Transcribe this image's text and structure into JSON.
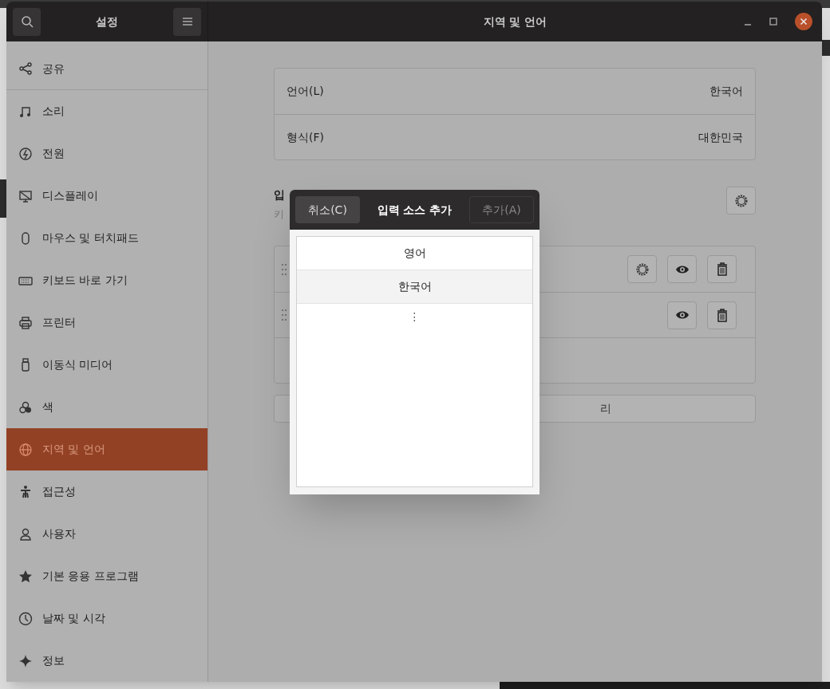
{
  "window": {
    "title": "설정",
    "page_title": "지역 및 언어"
  },
  "sidebar": {
    "items": [
      {
        "label": "공유",
        "selected": false
      },
      {
        "label": "소리",
        "selected": false
      },
      {
        "label": "전원",
        "selected": false
      },
      {
        "label": "디스플레이",
        "selected": false
      },
      {
        "label": "마우스 및 터치패드",
        "selected": false
      },
      {
        "label": "키보드 바로 가기",
        "selected": false
      },
      {
        "label": "프린터",
        "selected": false
      },
      {
        "label": "이동식 미디어",
        "selected": false
      },
      {
        "label": "색",
        "selected": false
      },
      {
        "label": "지역 및 언어",
        "selected": true
      },
      {
        "label": "접근성",
        "selected": false
      },
      {
        "label": "사용자",
        "selected": false
      },
      {
        "label": "기본 응용 프로그램",
        "selected": false
      },
      {
        "label": "날짜 및 시각",
        "selected": false
      },
      {
        "label": "정보",
        "selected": false
      }
    ]
  },
  "language": {
    "rows": [
      {
        "label": "언어(L)",
        "value": "한국어"
      },
      {
        "label": "형식(F)",
        "value": "대한민국"
      }
    ]
  },
  "input_sources": {
    "heading": "입",
    "subtitle": "키",
    "rows": [
      {
        "kind": "with_settings"
      },
      {
        "kind": "plain"
      },
      {
        "kind": "empty"
      }
    ],
    "manage_button": "리"
  },
  "dialog": {
    "cancel": "취소(C)",
    "title": "입력 소스 추가",
    "add": {
      "label": "추가(A)",
      "disabled": true
    },
    "items": [
      {
        "label": "영어",
        "selected": false
      },
      {
        "label": "한국어",
        "selected": true
      }
    ],
    "more": "⋮"
  }
}
